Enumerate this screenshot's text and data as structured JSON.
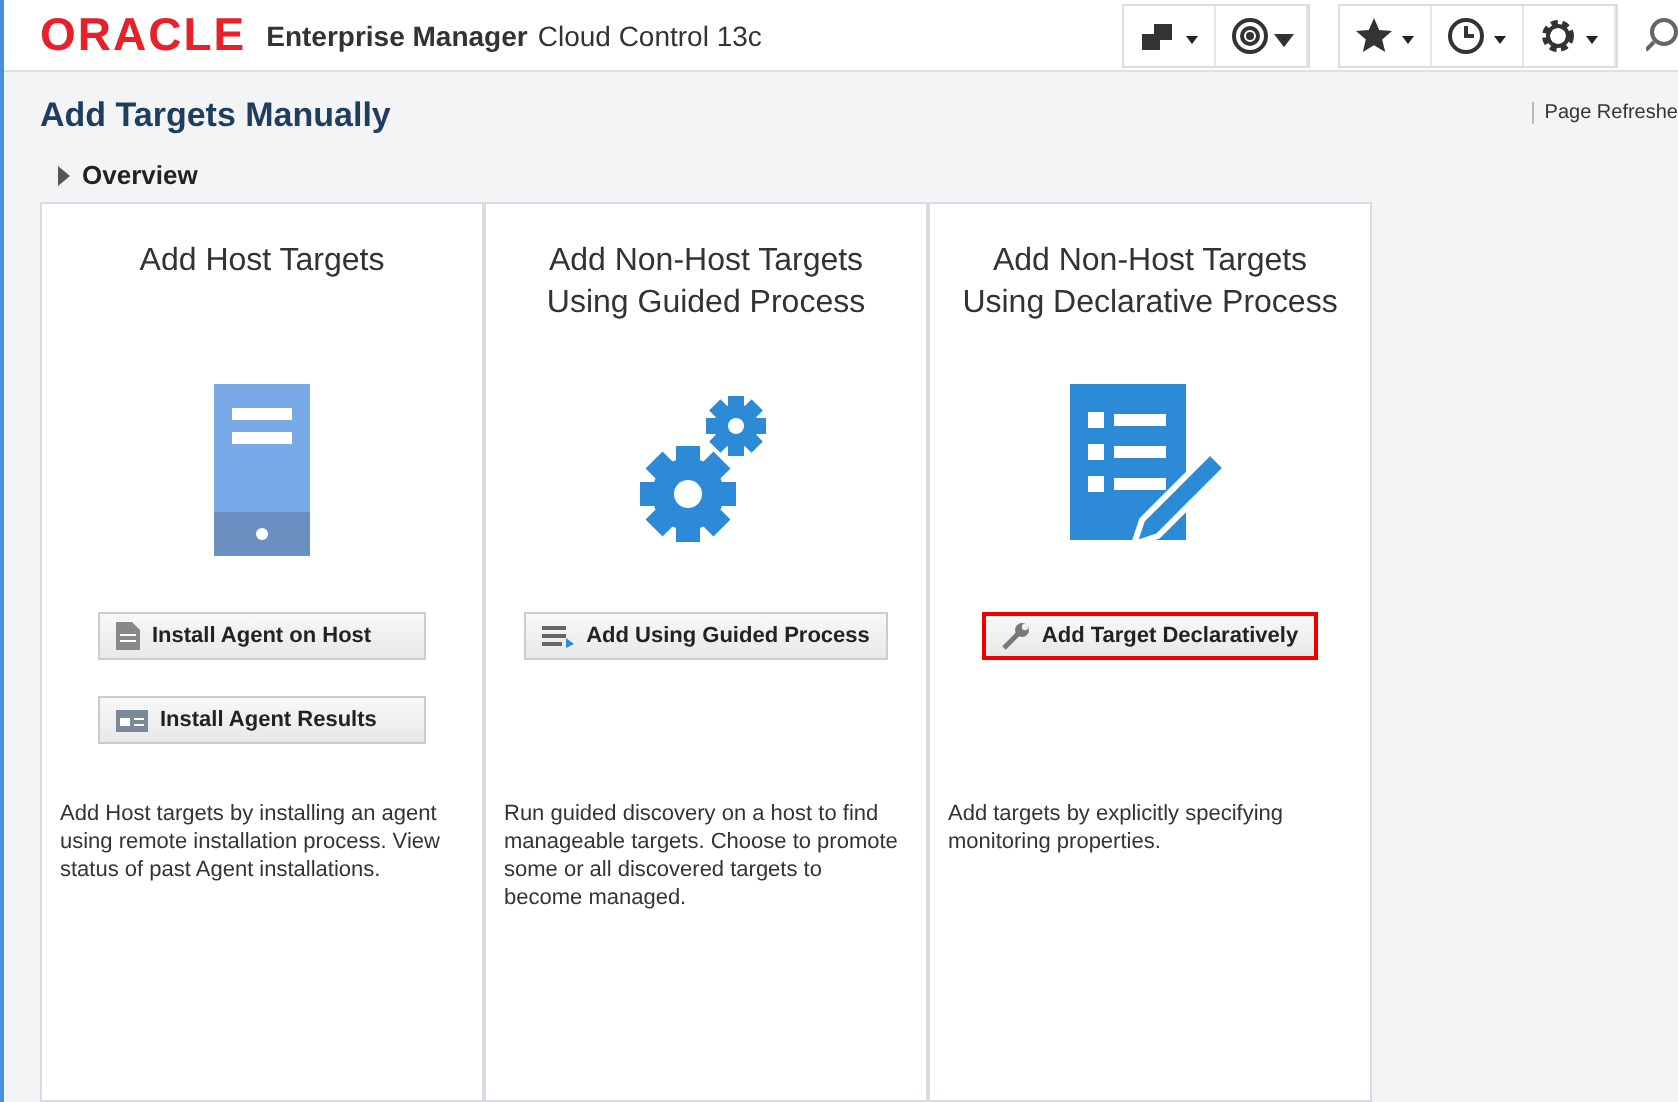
{
  "header": {
    "logo": "ORACLE",
    "product": "Enterprise Manager",
    "edition": "Cloud Control 13c"
  },
  "page": {
    "title": "Add Targets Manually",
    "refresh": "Page Refreshe",
    "overview": {
      "label": "Overview",
      "expanded": false
    }
  },
  "cards": [
    {
      "kind": "host",
      "title": "Add Host Targets",
      "buttons": [
        {
          "kind": "agent",
          "label": "Install Agent on Host",
          "highlighted": false
        },
        {
          "kind": "results",
          "label": "Install Agent Results",
          "highlighted": false
        }
      ],
      "description": "Add Host targets by installing an agent using remote installation process. View status of past Agent installations."
    },
    {
      "kind": "guided",
      "title": "Add Non-Host Targets Using Guided Process",
      "buttons": [
        {
          "kind": "guided",
          "label": "Add Using Guided Process",
          "highlighted": false
        }
      ],
      "description": "Run guided discovery on a host to find manageable targets. Choose to promote some or all discovered targets to become managed."
    },
    {
      "kind": "declarative",
      "title": "Add Non-Host Targets Using Declarative Process",
      "buttons": [
        {
          "kind": "wrench",
          "label": "Add Target Declaratively",
          "highlighted": true
        }
      ],
      "description": "Add targets by explicitly specifying monitoring properties."
    }
  ]
}
